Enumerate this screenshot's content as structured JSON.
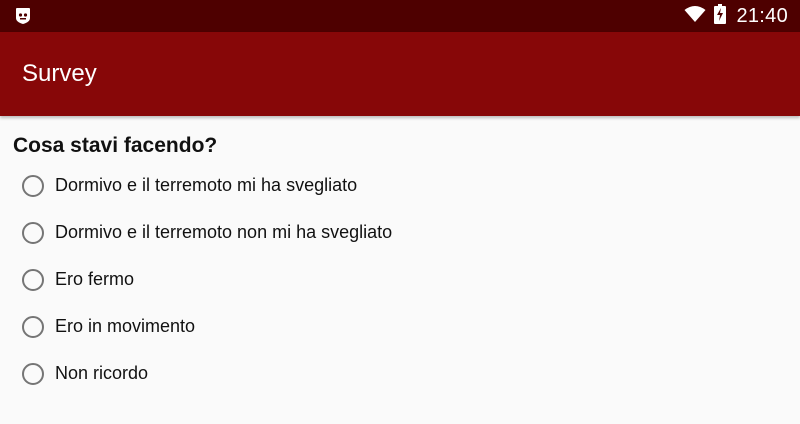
{
  "status_bar": {
    "left_icon": "notification-app-icon",
    "wifi_icon": "wifi-icon",
    "battery_icon": "battery-charging-icon",
    "time": "21:40"
  },
  "app_bar": {
    "title": "Survey"
  },
  "question": {
    "text": "Cosa stavi facendo?",
    "options": [
      {
        "label": "Dormivo e il terremoto mi ha svegliato",
        "selected": false
      },
      {
        "label": "Dormivo e il terremoto non mi ha svegliato",
        "selected": false
      },
      {
        "label": "Ero fermo",
        "selected": false
      },
      {
        "label": "Ero in movimento",
        "selected": false
      },
      {
        "label": "Non ricordo",
        "selected": false
      }
    ]
  },
  "colors": {
    "status_bar": "#4e0000",
    "app_bar": "#870708",
    "background": "#fafafa",
    "radio_border": "#757575"
  }
}
